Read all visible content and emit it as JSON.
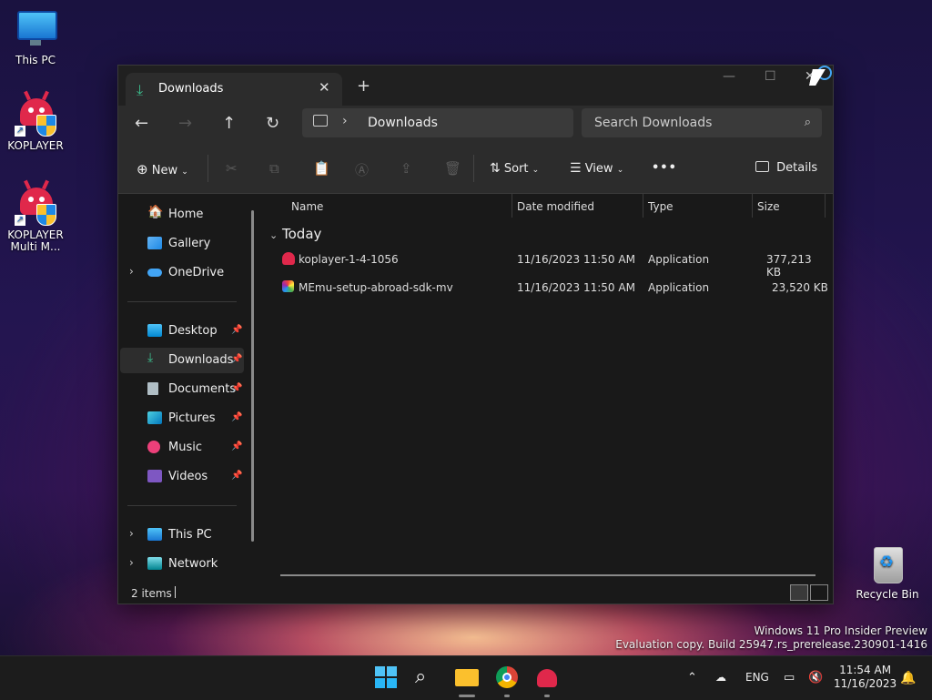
{
  "desktop": {
    "icons": [
      {
        "label": "This PC"
      },
      {
        "label": "KOPLAYER"
      },
      {
        "label": "KOPLAYER Multi M..."
      },
      {
        "label": "Recycle Bin"
      }
    ],
    "watermark": {
      "line1": "Windows 11 Pro Insider Preview",
      "line2": "Evaluation copy. Build 25947.rs_prerelease.230901-1416"
    }
  },
  "window": {
    "tab_title": "Downloads",
    "address": {
      "crumb": "Downloads"
    },
    "search": {
      "placeholder": "Search Downloads"
    },
    "commands": {
      "new": "New",
      "sort": "Sort",
      "view": "View",
      "more": "•••",
      "details": "Details"
    },
    "nav": {
      "items": [
        {
          "label": "Home"
        },
        {
          "label": "Gallery"
        },
        {
          "label": "OneDrive"
        },
        {
          "label": "Desktop"
        },
        {
          "label": "Downloads"
        },
        {
          "label": "Documents"
        },
        {
          "label": "Pictures"
        },
        {
          "label": "Music"
        },
        {
          "label": "Videos"
        },
        {
          "label": "This PC"
        },
        {
          "label": "Network"
        }
      ]
    },
    "columns": {
      "name": "Name",
      "date": "Date modified",
      "type": "Type",
      "size": "Size"
    },
    "group": "Today",
    "files": [
      {
        "name": "koplayer-1-4-1056",
        "date": "11/16/2023 11:50 AM",
        "type": "Application",
        "size": "377,213 KB"
      },
      {
        "name": "MEmu-setup-abroad-sdk-mv",
        "date": "11/16/2023 11:50 AM",
        "type": "Application",
        "size": "23,520 KB"
      }
    ],
    "status": {
      "count": "2 items"
    }
  },
  "taskbar": {
    "tray": {
      "lang": "ENG"
    },
    "clock": {
      "time": "11:54 AM",
      "date": "11/16/2023"
    }
  },
  "colors": {
    "accent": "#3cbf8e",
    "brand_red": "#e0284b",
    "window_bg": "#191919"
  }
}
